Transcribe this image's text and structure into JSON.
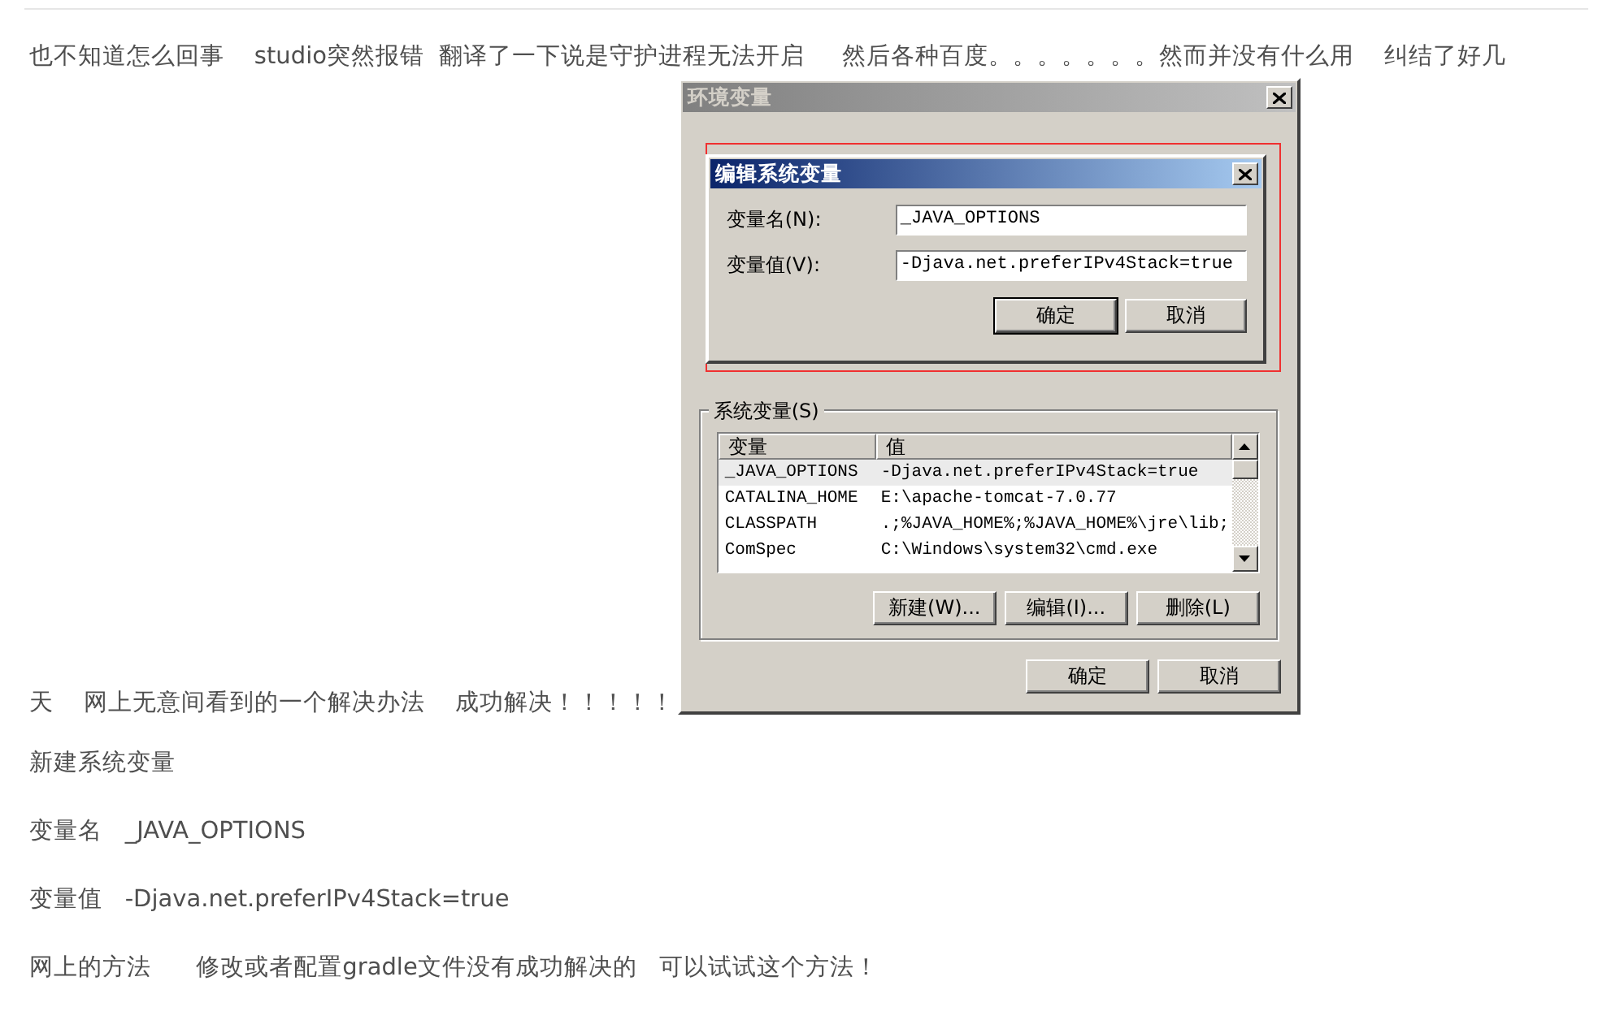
{
  "intro": {
    "line_1": "也不知道怎么回事    studio突然报错  翻译了一下说是守护进程无法开启     然后各种百度。。。。。。。然而并没有什么用    纠结了好几",
    "line_2": "天    网上无意间看到的一个解决办法    成功解决！！！！！"
  },
  "screenshot": {
    "window": {
      "title": "环境变量"
    },
    "edit_dialog": {
      "title": "编辑系统变量",
      "fields": [
        {
          "label": "变量名(N):",
          "value": "_JAVA_OPTIONS"
        },
        {
          "label": "变量值(V):",
          "value": "-Djava.net.preferIPv4Stack=true"
        }
      ],
      "buttons": [
        "确定",
        "取消"
      ]
    },
    "system_variables": {
      "title": "系统变量(S)",
      "columns": [
        "变量",
        "值"
      ],
      "rows": [
        {
          "name": "_JAVA_OPTIONS",
          "value": "-Djava.net.preferIPv4Stack=true",
          "selected": true
        },
        {
          "name": "CATALINA_HOME",
          "value": "E:\\apache-tomcat-7.0.77",
          "selected": false
        },
        {
          "name": "CLASSPATH",
          "value": ".;%JAVA_HOME%;%JAVA_HOME%\\jre\\lib;",
          "selected": false
        },
        {
          "name": "ComSpec",
          "value": "C:\\Windows\\system32\\cmd.exe",
          "selected": false
        }
      ],
      "buttons": [
        "新建(W)...",
        "编辑(I)...",
        "删除(L)"
      ]
    },
    "buttons": [
      "确定",
      "取消"
    ]
  },
  "paragraphs": [
    "新建系统变量",
    "变量名   _JAVA_OPTIONS",
    "变量值   -Djava.net.preferIPv4Stack=true",
    "网上的方法      修改或者配置gradle文件没有成功解决的   可以试试这个方法！"
  ]
}
